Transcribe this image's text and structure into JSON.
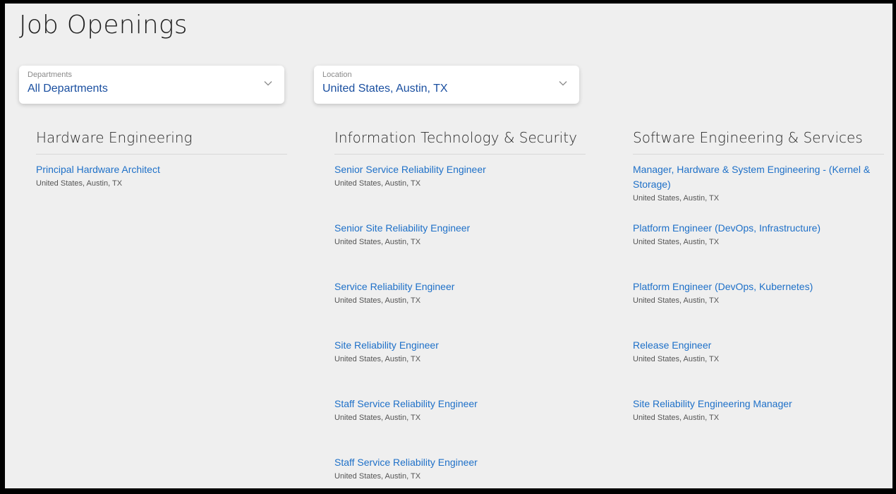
{
  "page": {
    "title": "Job Openings"
  },
  "filters": {
    "departments": {
      "label": "Departments",
      "value": "All Departments"
    },
    "location": {
      "label": "Location",
      "value": "United States, Austin, TX"
    }
  },
  "columns": [
    {
      "heading": "Hardware Engineering",
      "jobs": [
        {
          "title": "Principal Hardware Architect",
          "location": "United States, Austin, TX"
        }
      ]
    },
    {
      "heading": "Information Technology & Security",
      "jobs": [
        {
          "title": "Senior Service Reliability Engineer",
          "location": "United States, Austin, TX"
        },
        {
          "title": "Senior Site Reliability Engineer",
          "location": "United States, Austin, TX"
        },
        {
          "title": "Service Reliability Engineer",
          "location": "United States, Austin, TX"
        },
        {
          "title": "Site Reliability Engineer",
          "location": "United States, Austin, TX"
        },
        {
          "title": "Staff Service Reliability Engineer",
          "location": "United States, Austin, TX"
        },
        {
          "title": "Staff Service Reliability Engineer",
          "location": "United States, Austin, TX"
        }
      ]
    },
    {
      "heading": "Software Engineering & Services",
      "jobs": [
        {
          "title": "Manager, Hardware & System Engineering - (Kernel & Storage)",
          "location": "United States, Austin, TX"
        },
        {
          "title": "Platform Engineer (DevOps, Infrastructure)",
          "location": "United States, Austin, TX"
        },
        {
          "title": "Platform Engineer (DevOps, Kubernetes)",
          "location": "United States, Austin, TX"
        },
        {
          "title": "Release Engineer",
          "location": "United States, Austin, TX"
        },
        {
          "title": "Site Reliability Engineering Manager",
          "location": "United States, Austin, TX"
        }
      ]
    }
  ],
  "icons": {
    "dropdown": "chevron-down-icon"
  },
  "colors": {
    "background": "#efefef",
    "link": "#1e70c8",
    "select_value": "#1a4fa0"
  }
}
